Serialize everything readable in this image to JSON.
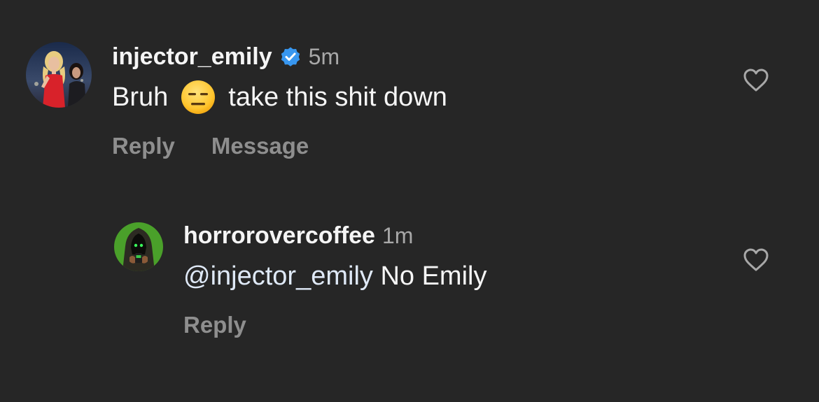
{
  "comments": [
    {
      "username": "injector_emily",
      "verified": true,
      "time": "5m",
      "text_before": "Bruh",
      "emoji": "expressionless-face-emoji",
      "text_after": "take this shit down",
      "actions": [
        "Reply",
        "Message"
      ]
    },
    {
      "username": "horrorovercoffee",
      "time": "1m",
      "mention": "@injector_emily",
      "text": " No Emily",
      "actions": [
        "Reply"
      ]
    }
  ],
  "colors": {
    "background": "#262626",
    "verified": "#3897f0",
    "secondary_text": "#a8a8a8",
    "action_text": "#8e8e8e"
  }
}
